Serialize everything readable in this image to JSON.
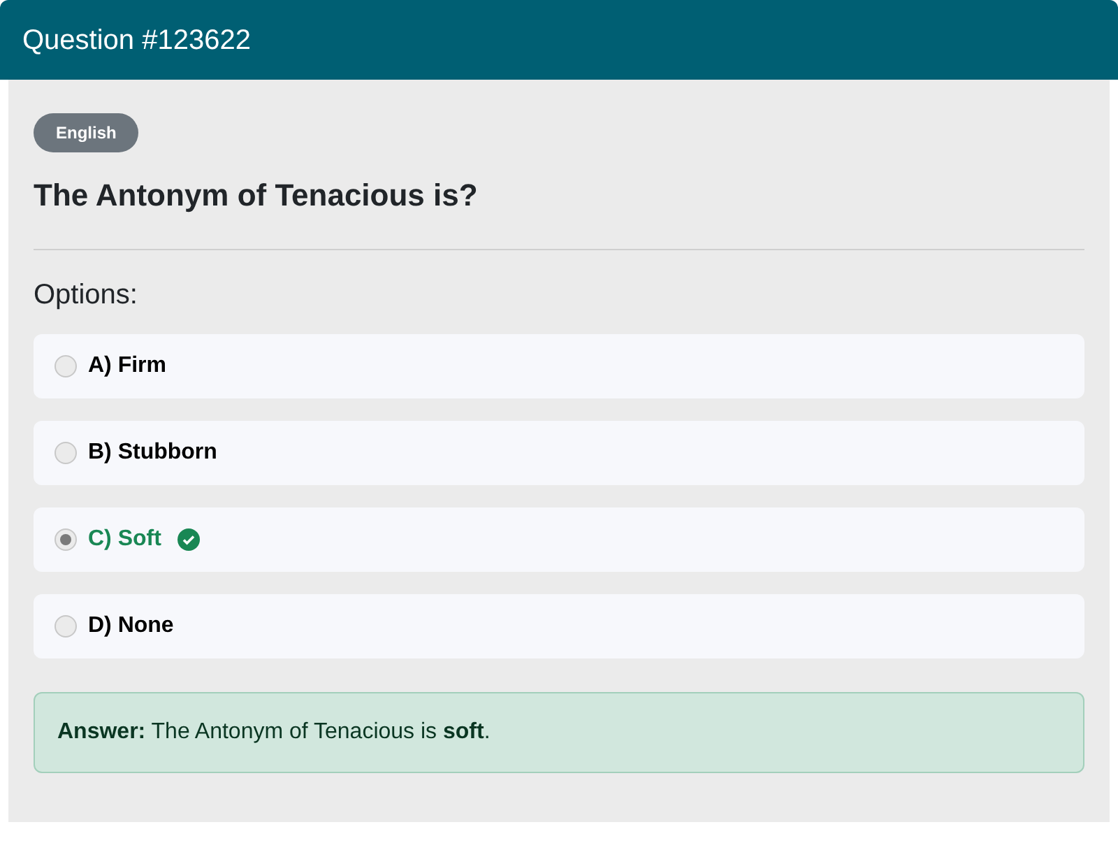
{
  "header": {
    "title": "Question #123622"
  },
  "question": {
    "tag": "English",
    "text": "The Antonym of Tenacious is?"
  },
  "options_label": "Options:",
  "options": [
    {
      "label": "A) Firm",
      "selected": false,
      "correct": false
    },
    {
      "label": "B) Stubborn",
      "selected": false,
      "correct": false
    },
    {
      "label": "C) Soft",
      "selected": true,
      "correct": true
    },
    {
      "label": "D) None",
      "selected": false,
      "correct": false
    }
  ],
  "answer": "**Answer:** The Antonym of Tenacious is **soft**."
}
